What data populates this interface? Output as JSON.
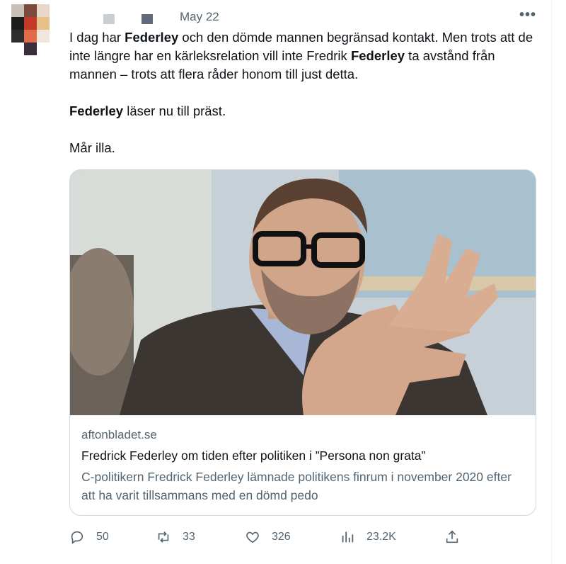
{
  "tweet": {
    "date": "May 22",
    "more_icon": "more-horizontal-icon",
    "paragraphs": [
      {
        "parts": [
          {
            "text": "I dag har ",
            "bold": false
          },
          {
            "text": "Federley",
            "bold": true
          },
          {
            "text": " och den dömde mannen begränsad kontakt. Men trots att de inte längre har en kärleksrelation vill inte Fredrik ",
            "bold": false
          },
          {
            "text": "Federley",
            "bold": true
          },
          {
            "text": " ta avstånd från mannen – trots att flera råder honom till just detta.",
            "bold": false
          }
        ]
      },
      {
        "parts": [
          {
            "text": "Federley",
            "bold": true
          },
          {
            "text": " läser nu till präst.",
            "bold": false
          }
        ]
      },
      {
        "parts": [
          {
            "text": "Mår illa.",
            "bold": false
          }
        ]
      }
    ]
  },
  "card": {
    "domain": "aftonbladet.se",
    "title": "Fredrick Federley om tiden efter politiken i ”Persona non grata”",
    "description": "C-politikern Fredrick Federley lämnade politikens finrum i november 2020 efter att ha varit tillsammans med en dömd pedo"
  },
  "actions": {
    "replies": {
      "icon": "reply-icon",
      "count": "50"
    },
    "retweets": {
      "icon": "retweet-icon",
      "count": "33"
    },
    "likes": {
      "icon": "like-heart-icon",
      "count": "326"
    },
    "views": {
      "icon": "views-chart-icon",
      "count": "23.2K"
    },
    "share": {
      "icon": "share-icon"
    }
  },
  "colors": {
    "text": "#0f1419",
    "secondary": "#536471",
    "border": "#cfd9de"
  }
}
